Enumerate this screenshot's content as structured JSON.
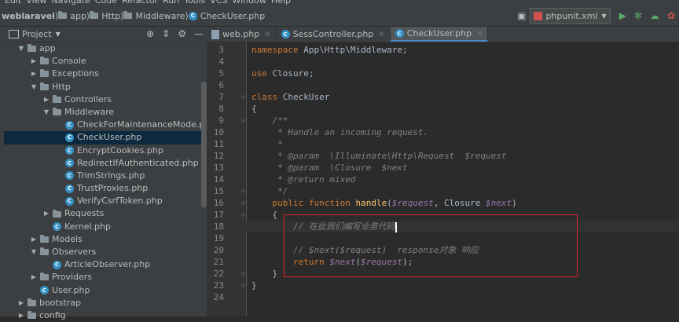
{
  "menubar": [
    "Edit",
    "View",
    "Navigate",
    "Code",
    "Refactor",
    "Run",
    "Tools",
    "VCS",
    "Window",
    "Help"
  ],
  "breadcrumbs": [
    "weblaravel",
    "app",
    "Http",
    "Middleware",
    "CheckUser.php"
  ],
  "run_config": "phpunit.xml",
  "project_panel": {
    "title": "Project"
  },
  "tree": [
    {
      "label": "app",
      "type": "folder",
      "depth": 0,
      "expanded": true
    },
    {
      "label": "Console",
      "type": "folder",
      "depth": 1,
      "expanded": false
    },
    {
      "label": "Exceptions",
      "type": "folder",
      "depth": 1,
      "expanded": false
    },
    {
      "label": "Http",
      "type": "folder",
      "depth": 1,
      "expanded": true
    },
    {
      "label": "Controllers",
      "type": "folder",
      "depth": 2,
      "expanded": false
    },
    {
      "label": "Middleware",
      "type": "folder",
      "depth": 2,
      "expanded": true
    },
    {
      "label": "CheckForMaintenanceMode.php",
      "type": "php",
      "depth": 3
    },
    {
      "label": "CheckUser.php",
      "type": "php",
      "depth": 3,
      "selected": true
    },
    {
      "label": "EncryptCookies.php",
      "type": "php",
      "depth": 3
    },
    {
      "label": "RedirectIfAuthenticated.php",
      "type": "php",
      "depth": 3
    },
    {
      "label": "TrimStrings.php",
      "type": "php",
      "depth": 3
    },
    {
      "label": "TrustProxies.php",
      "type": "php",
      "depth": 3
    },
    {
      "label": "VerifyCsrfToken.php",
      "type": "php",
      "depth": 3
    },
    {
      "label": "Requests",
      "type": "folder",
      "depth": 2,
      "expanded": false
    },
    {
      "label": "Kernel.php",
      "type": "php",
      "depth": 2
    },
    {
      "label": "Models",
      "type": "folder",
      "depth": 1,
      "expanded": false
    },
    {
      "label": "Observers",
      "type": "folder",
      "depth": 1,
      "expanded": true
    },
    {
      "label": "ArticleObserver.php",
      "type": "php",
      "depth": 2
    },
    {
      "label": "Providers",
      "type": "folder",
      "depth": 1,
      "expanded": false
    },
    {
      "label": "User.php",
      "type": "php",
      "depth": 1
    },
    {
      "label": "bootstrap",
      "type": "folder",
      "depth": 0,
      "expanded": false
    },
    {
      "label": "config",
      "type": "folder",
      "depth": 0,
      "expanded": false
    }
  ],
  "tabs": [
    {
      "label": "web.php",
      "icon": "web-file-icon",
      "active": false
    },
    {
      "label": "SessController.php",
      "icon": "php-class-icon",
      "active": false
    },
    {
      "label": "CheckUser.php",
      "icon": "php-class-icon",
      "active": true
    }
  ],
  "code_lines": [
    {
      "num": "3",
      "tokens": [
        [
          "kw",
          "namespace "
        ],
        [
          "pl",
          "App\\Http\\Middleware;"
        ]
      ]
    },
    {
      "num": "4",
      "tokens": []
    },
    {
      "num": "5",
      "tokens": [
        [
          "kw",
          "use "
        ],
        [
          "pl",
          "Closure;"
        ]
      ]
    },
    {
      "num": "6",
      "tokens": []
    },
    {
      "num": "7",
      "tokens": [
        [
          "kw",
          "class "
        ],
        [
          "pl",
          "CheckUser"
        ]
      ]
    },
    {
      "num": "8",
      "tokens": [
        [
          "pl",
          "{"
        ]
      ]
    },
    {
      "num": "9",
      "tokens": [
        [
          "cm",
          "    /**"
        ]
      ]
    },
    {
      "num": "10",
      "tokens": [
        [
          "cm",
          "     * Handle an incoming request."
        ]
      ]
    },
    {
      "num": "11",
      "tokens": [
        [
          "cm",
          "     *"
        ]
      ]
    },
    {
      "num": "12",
      "tokens": [
        [
          "cm",
          "     * @param  \\Illuminate\\Http\\Request  $request"
        ]
      ]
    },
    {
      "num": "13",
      "tokens": [
        [
          "cm",
          "     * @param  \\Closure  $next"
        ]
      ]
    },
    {
      "num": "14",
      "tokens": [
        [
          "cm",
          "     * @return mixed"
        ]
      ]
    },
    {
      "num": "15",
      "tokens": [
        [
          "cm",
          "     */"
        ]
      ]
    },
    {
      "num": "16",
      "tokens": [
        [
          "kw",
          "    public function "
        ],
        [
          "fn",
          "handle"
        ],
        [
          "pl",
          "("
        ],
        [
          "var",
          "$request"
        ],
        [
          "pl",
          ", Closure "
        ],
        [
          "var",
          "$next"
        ],
        [
          "pl",
          ")"
        ]
      ]
    },
    {
      "num": "17",
      "tokens": [
        [
          "pl",
          "    {"
        ]
      ]
    },
    {
      "num": "18",
      "tokens": [
        [
          "cm",
          "        // 在此我们编写业务代码"
        ]
      ],
      "current": true,
      "caret": true
    },
    {
      "num": "19",
      "tokens": []
    },
    {
      "num": "20",
      "tokens": [
        [
          "cm",
          "        // $next($request)  response对象 响应"
        ]
      ]
    },
    {
      "num": "21",
      "tokens": [
        [
          "kw",
          "        return "
        ],
        [
          "var",
          "$next"
        ],
        [
          "pl",
          "("
        ],
        [
          "var",
          "$request"
        ],
        [
          "pl",
          ");"
        ]
      ]
    },
    {
      "num": "22",
      "tokens": [
        [
          "pl",
          "    }"
        ]
      ]
    },
    {
      "num": "23",
      "tokens": [
        [
          "pl",
          "}"
        ]
      ]
    },
    {
      "num": "24",
      "tokens": []
    }
  ]
}
